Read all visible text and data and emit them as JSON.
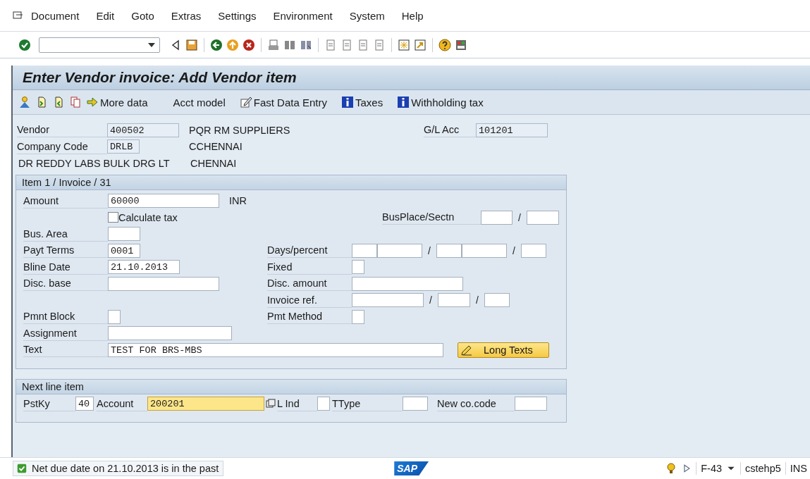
{
  "menu": [
    "Document",
    "Edit",
    "Goto",
    "Extras",
    "Settings",
    "Environment",
    "System",
    "Help"
  ],
  "title": "Enter Vendor invoice: Add Vendor item",
  "app_toolbar": [
    {
      "label": "More data"
    },
    {
      "label": "Acct model"
    },
    {
      "label": "Fast Data Entry"
    },
    {
      "label": "Taxes"
    },
    {
      "label": "Withholding tax"
    }
  ],
  "header": {
    "vendor": {
      "label": "Vendor",
      "value": "400502",
      "name": "PQR RM SUPPLIERS"
    },
    "gl_acc": {
      "label": "G/L Acc",
      "value": "101201"
    },
    "company_code": {
      "label": "Company Code",
      "value": "DRLB",
      "city": "CCHENNAI"
    },
    "company_name": "DR REDDY LABS BULK DRG LT",
    "company_city": "CHENNAI"
  },
  "item": {
    "title": "Item 1 / Invoice / 31",
    "amount": {
      "label": "Amount",
      "value": "60000",
      "currency": "INR"
    },
    "calculate_tax": {
      "label": "Calculate tax",
      "checked": false
    },
    "bus_place": {
      "label": "BusPlace/Sectn",
      "separator": "/"
    },
    "bus_area": {
      "label": "Bus. Area"
    },
    "payt_terms": {
      "label": "Payt Terms",
      "value": "0001"
    },
    "days_percent": {
      "label": "Days/percent",
      "separators": [
        "/",
        "/"
      ]
    },
    "bline_date": {
      "label": "Bline Date",
      "value": "21.10.2013"
    },
    "fixed": {
      "label": "Fixed"
    },
    "disc_base": {
      "label": "Disc. base"
    },
    "disc_amount": {
      "label": "Disc. amount"
    },
    "invoice_ref": {
      "label": "Invoice ref.",
      "separators": [
        "/",
        "/"
      ]
    },
    "pmnt_block": {
      "label": "Pmnt Block"
    },
    "pmt_method": {
      "label": "Pmt Method"
    },
    "assignment": {
      "label": "Assignment"
    },
    "text": {
      "label": "Text",
      "value": "TEST FOR BRS-MBS"
    },
    "long_texts_button": "Long Texts"
  },
  "next_line": {
    "title": "Next line item",
    "pstky": {
      "label": "PstKy",
      "value": "40"
    },
    "account": {
      "label": "Account",
      "value": "200201"
    },
    "gl_ind": {
      "label": "L Ind"
    },
    "ttype": {
      "label": "TType"
    },
    "new_co_code": {
      "label": "New co.code"
    }
  },
  "status": {
    "message": "Net due date on 21.10.2013 is in the past",
    "logo": "SAP",
    "transaction": "F-43",
    "server": "cstehp5",
    "mode": "INS"
  }
}
